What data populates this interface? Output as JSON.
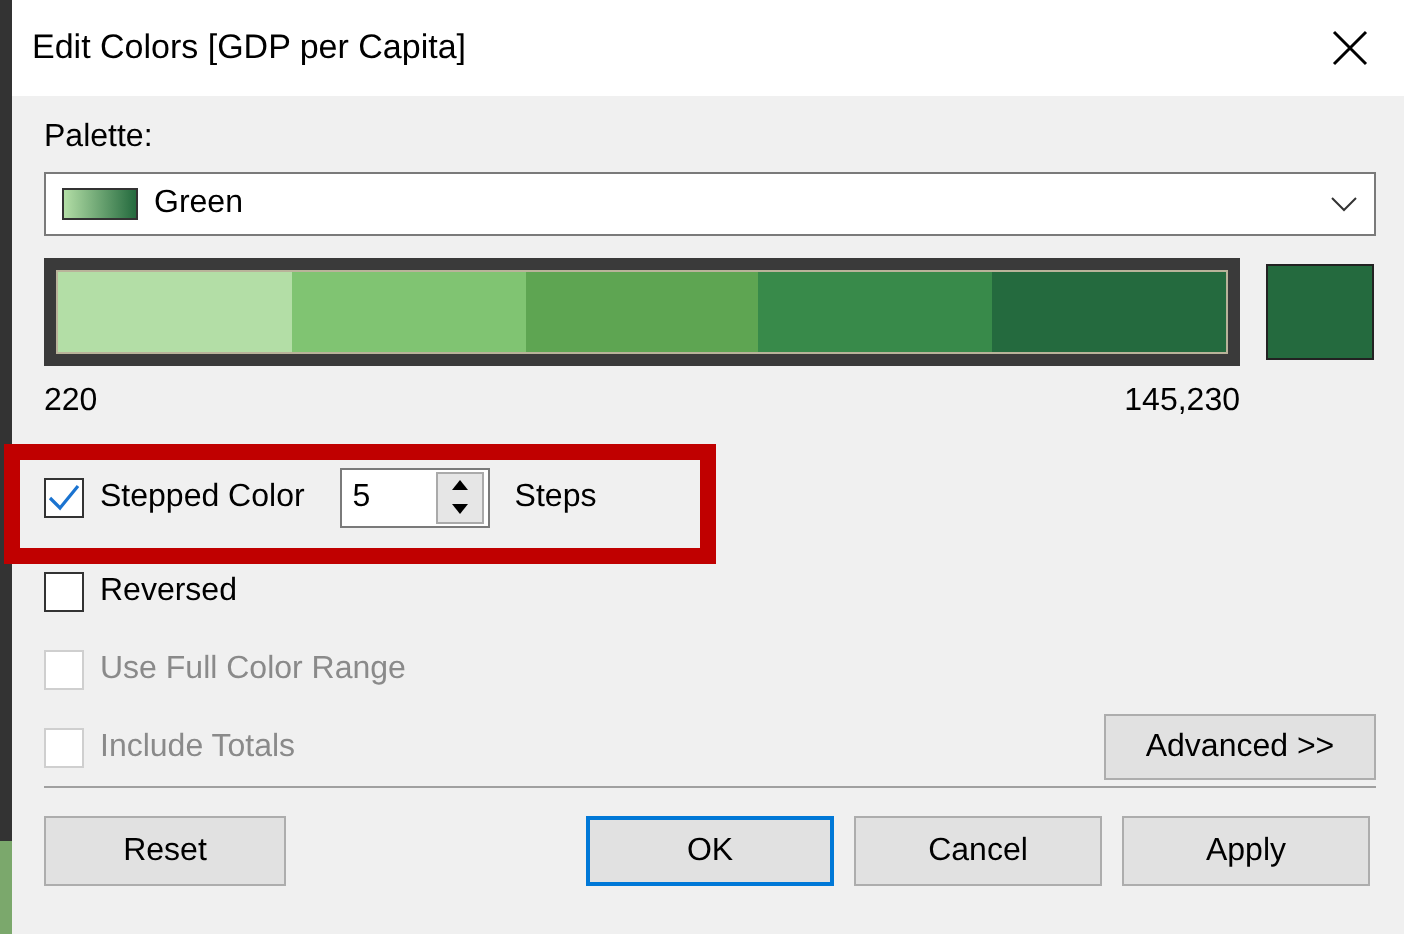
{
  "window": {
    "title": "Edit Colors [GDP per Capita]"
  },
  "palette": {
    "label": "Palette:",
    "value": "Green"
  },
  "color_bar": {
    "segments": [
      {
        "color": "#b3dea6"
      },
      {
        "color": "#80c472"
      },
      {
        "color": "#5ea552"
      },
      {
        "color": "#388a4a"
      },
      {
        "color": "#246a3e"
      }
    ],
    "min": "220",
    "max": "145,230"
  },
  "stepped": {
    "label": "Stepped Color",
    "checked": true,
    "steps_value": "5",
    "steps_label": "Steps"
  },
  "options": [
    {
      "label": "Reversed",
      "checked": false,
      "disabled": false
    },
    {
      "label": "Use Full Color Range",
      "checked": false,
      "disabled": true
    },
    {
      "label": "Include Totals",
      "checked": false,
      "disabled": true
    }
  ],
  "advanced_button": "Advanced >>",
  "buttons": [
    {
      "label": "Reset",
      "default": false
    },
    {
      "label": "OK",
      "default": true
    },
    {
      "label": "Cancel",
      "default": false
    },
    {
      "label": "Apply",
      "default": false
    }
  ]
}
